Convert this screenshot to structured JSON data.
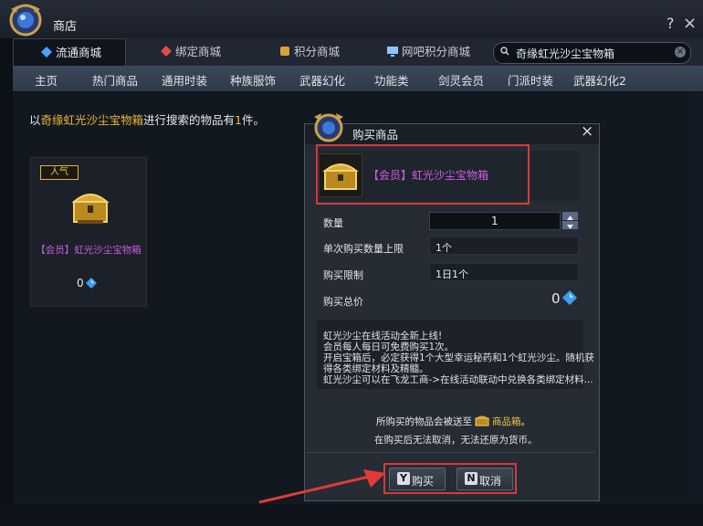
{
  "window": {
    "title": "商店",
    "help": "?",
    "close": "×"
  },
  "tabs": [
    {
      "label": "流通商城"
    },
    {
      "label": "绑定商城"
    },
    {
      "label": "积分商城"
    },
    {
      "label": "网吧积分商城"
    }
  ],
  "search": {
    "value": "奇缘虹光沙尘宝物箱",
    "clear": "×"
  },
  "subnav": [
    "主页",
    "热门商品",
    "通用时装",
    "种族服饰",
    "武器幻化",
    "功能类",
    "剑灵会员",
    "门派时装",
    "武器幻化2"
  ],
  "result": {
    "prefix": "以",
    "keyword": "奇缘虹光沙尘宝物箱",
    "mid": "进行搜索的物品有",
    "count": "1",
    "suffix": "件。"
  },
  "card": {
    "badge": "人气",
    "name": "【会员】虹光沙尘宝物箱",
    "price": "0"
  },
  "dialog": {
    "title": "购买商品",
    "close": "×",
    "item_name": "【会员】虹光沙尘宝物箱",
    "qty_label": "数量",
    "qty_value": "1",
    "limit_label": "单次购买数量上限",
    "limit_value": "1个",
    "restrict_label": "购买限制",
    "restrict_value": "1日1个",
    "total_label": "购买总价",
    "total_value": "0",
    "desc": [
      "虹光沙尘在线活动全新上线!",
      "会员每人每日可免费购买1次。",
      "开启宝箱后，必定获得1个大型幸运秘药和1个虹光沙尘。随机获",
      "得各类绑定材料及精髓。",
      "虹光沙尘可以在飞龙工商->在线活动联动中兑换各类绑定材料..."
    ],
    "note1_pre": "所购买的物品会被送至",
    "note1_box": "商品箱",
    "note1_post": "。",
    "note2": "在购买后无法取消，无法还原为货币。",
    "buy_key": "Y",
    "buy_label": "购买",
    "cancel_key": "N",
    "cancel_label": "取消"
  },
  "colors": {
    "accent": "#f2b634",
    "member": "#cf5ce8",
    "highlight_box": "#d9393a"
  }
}
